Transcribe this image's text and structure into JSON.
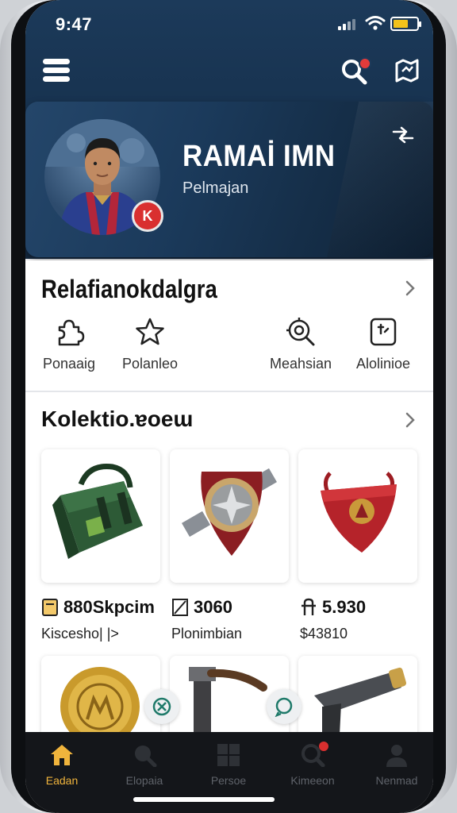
{
  "status": {
    "time": "9:47"
  },
  "profile": {
    "name": "RAMAİ IMN",
    "role": "Pelmajan",
    "badge": "K"
  },
  "section1": {
    "title": "Relafianokdalgra",
    "actions": [
      {
        "label": "Ponaaig",
        "icon": "puzzle-icon"
      },
      {
        "label": "Polanleo",
        "icon": "star-icon"
      },
      {
        "label": "Meahsian",
        "icon": "target-search-icon"
      },
      {
        "label": "Alolinioe",
        "icon": "document-icon"
      }
    ]
  },
  "section2": {
    "title": "Kolektio.ɐoeɯ",
    "items": [
      {
        "price": "880Skpcim",
        "subtitle": "Kiscesho| |>",
        "icon": "gold-bar-icon"
      },
      {
        "price": "3060",
        "subtitle": "Plonimbian",
        "icon": "slash-box-icon"
      },
      {
        "price": "5.930",
        "subtitle": "$43810",
        "icon": "handle-icon"
      }
    ]
  },
  "bottom_nav": [
    {
      "label": "Eadan",
      "icon": "home-icon",
      "active": true
    },
    {
      "label": "Elopaia",
      "icon": "search-bubble-icon",
      "active": false
    },
    {
      "label": "Persoe",
      "icon": "grid-icon",
      "active": false
    },
    {
      "label": "Kimeeon",
      "icon": "search-icon",
      "active": false
    },
    {
      "label": "Nenmad",
      "icon": "user-icon",
      "active": false
    }
  ],
  "colors": {
    "header": "#1c3a5a",
    "accent": "#f0b43c",
    "alert": "#d92f2f"
  }
}
